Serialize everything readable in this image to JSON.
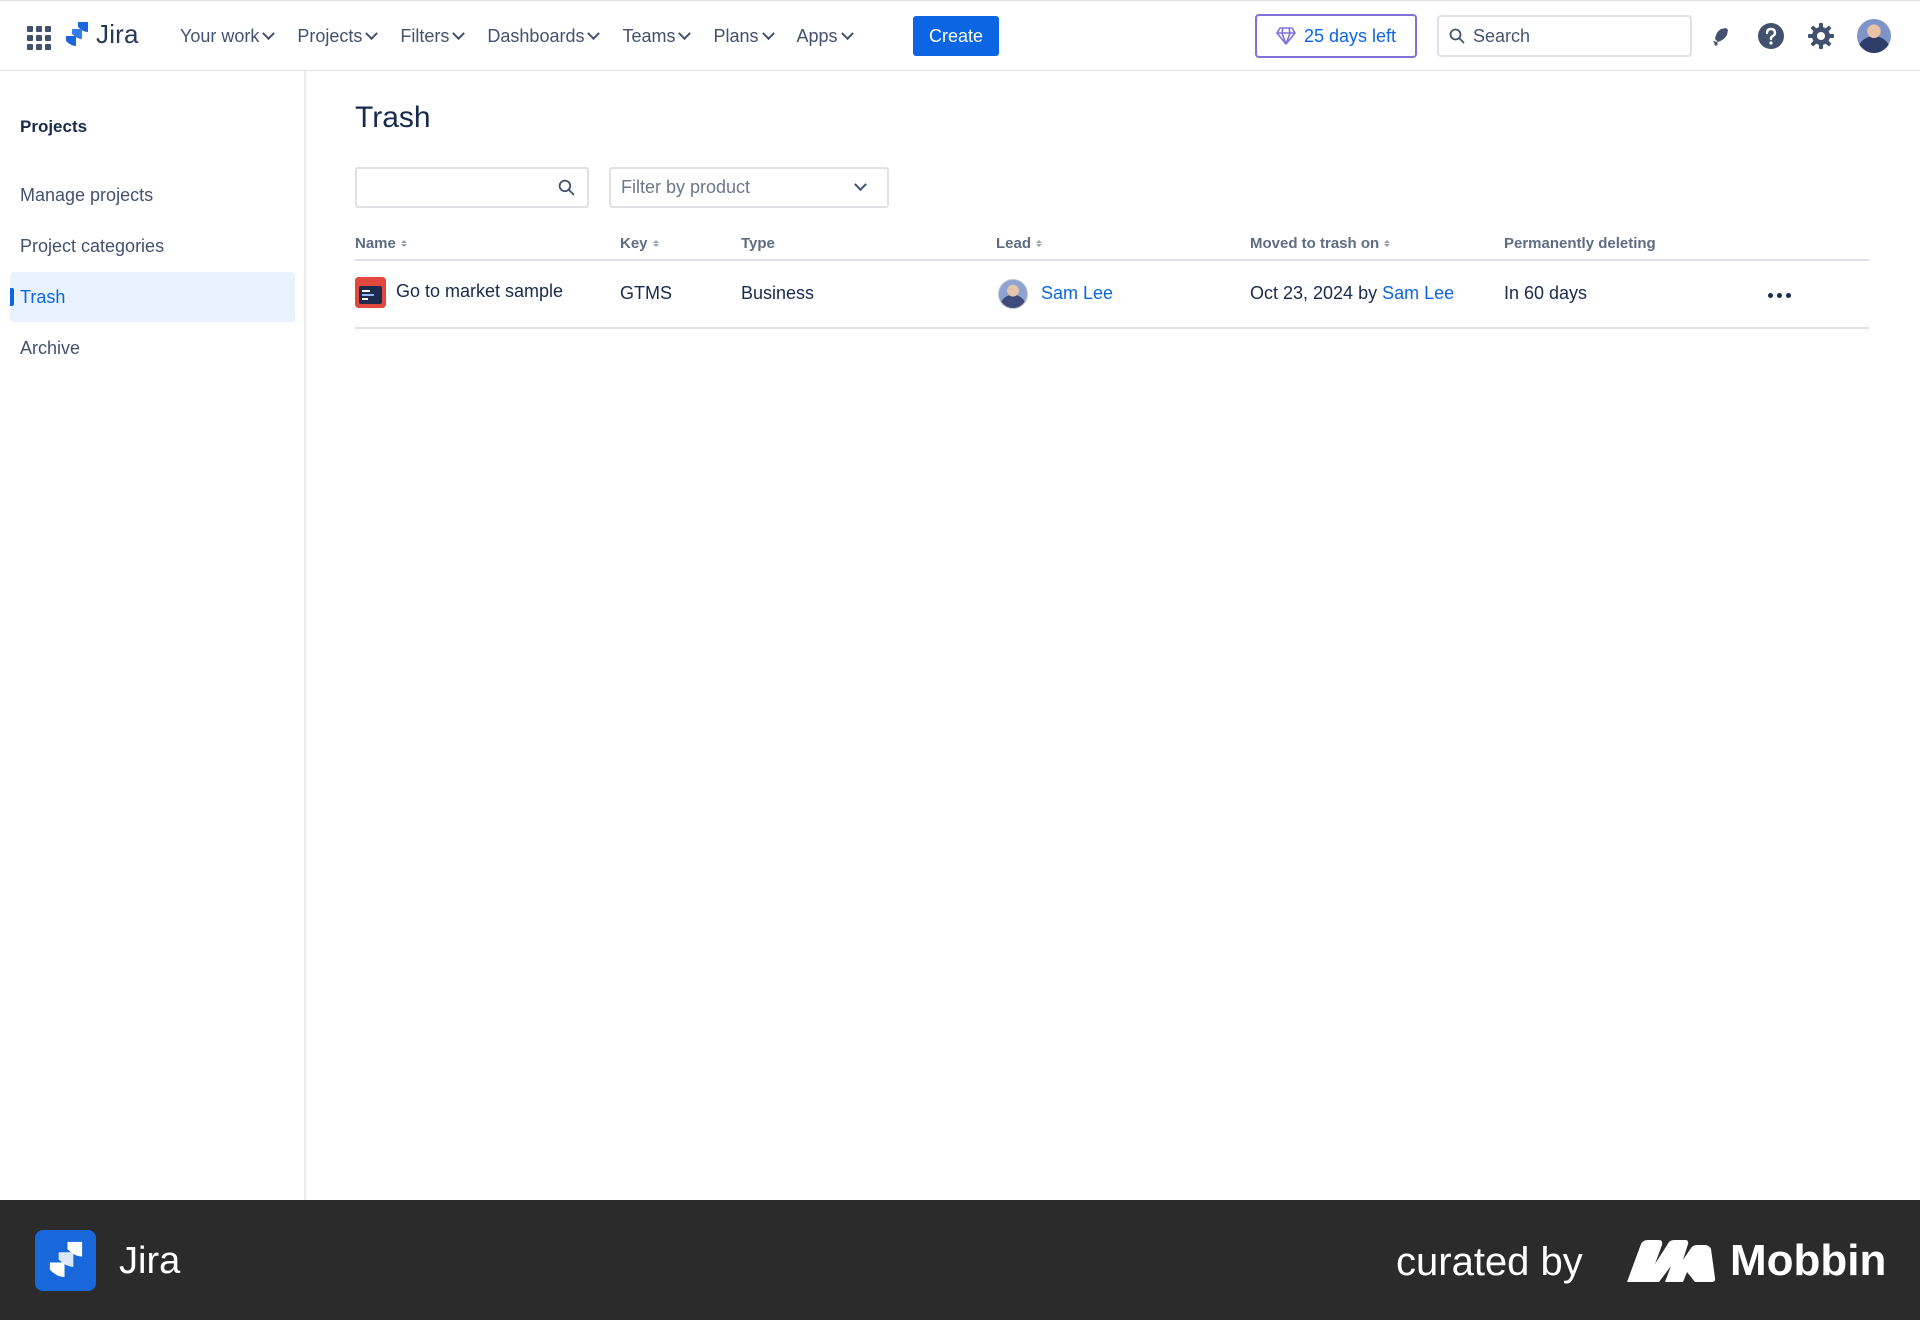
{
  "topnav": {
    "product_name": "Jira",
    "items": [
      {
        "label": "Your work"
      },
      {
        "label": "Projects"
      },
      {
        "label": "Filters"
      },
      {
        "label": "Dashboards"
      },
      {
        "label": "Teams"
      },
      {
        "label": "Plans"
      },
      {
        "label": "Apps"
      }
    ],
    "create_label": "Create",
    "trial_label": "25 days left",
    "search_placeholder": "Search"
  },
  "sidebar": {
    "title": "Projects",
    "items": [
      {
        "label": "Manage projects",
        "active": false
      },
      {
        "label": "Project categories",
        "active": false
      },
      {
        "label": "Trash",
        "active": true
      },
      {
        "label": "Archive",
        "active": false
      }
    ]
  },
  "main": {
    "title": "Trash",
    "search_value": "",
    "filter_placeholder": "Filter by product",
    "columns": {
      "name": "Name",
      "key": "Key",
      "type": "Type",
      "lead": "Lead",
      "moved": "Moved to trash on",
      "deleting": "Permanently deleting"
    },
    "rows": [
      {
        "name": "Go to market sample",
        "key": "GTMS",
        "type": "Business",
        "lead": "Sam Lee",
        "moved_date": "Oct 23, 2024",
        "moved_by_prefix": "by",
        "moved_by": "Sam Lee",
        "deleting": "In 60 days"
      }
    ]
  },
  "footer": {
    "product_name": "Jira",
    "curated_label": "curated by",
    "brand": "Mobbin"
  },
  "colors": {
    "accent": "#0c66e4",
    "trial_border": "#8270db",
    "footer_bg": "#2b2b2b"
  },
  "icons": [
    "app-switcher-icon",
    "jira-logo-icon",
    "diamond-icon",
    "search-icon",
    "notification-bell-icon",
    "help-icon",
    "settings-gear-icon",
    "user-avatar",
    "chevron-down-icon",
    "sort-icon",
    "more-actions-icon"
  ]
}
